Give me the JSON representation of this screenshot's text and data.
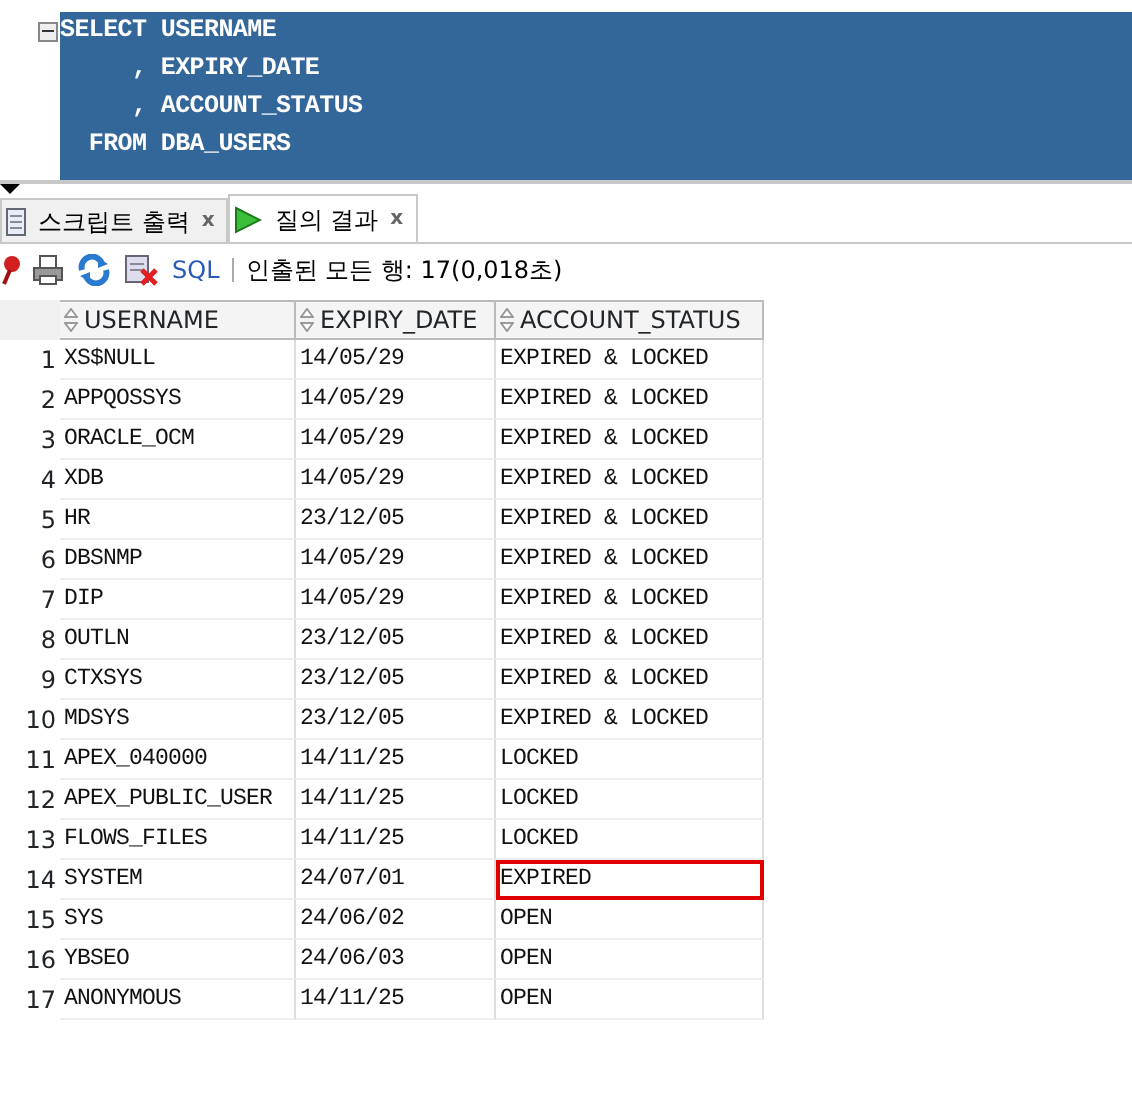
{
  "editor": {
    "lines": [
      {
        "text": "SELECT USERNAME",
        "foldable": true
      },
      {
        "text": "     , EXPIRY_DATE",
        "foldable": false
      },
      {
        "text": "     , ACCOUNT_STATUS",
        "foldable": false
      },
      {
        "text": "  FROM DBA_USERS",
        "foldable": false
      }
    ]
  },
  "tabs": [
    {
      "label": "스크립트 출력",
      "selected": false,
      "close": "x"
    },
    {
      "label": "질의 결과",
      "selected": true,
      "close": "x"
    }
  ],
  "toolbar": {
    "sql": "SQL",
    "status": "인출된 모든 행: 17(0,018초)"
  },
  "table": {
    "columns": [
      "USERNAME",
      "EXPIRY_DATE",
      "ACCOUNT_STATUS"
    ],
    "rows": [
      {
        "num": "1",
        "cells": [
          "XS$NULL",
          "14/05/29",
          "EXPIRED & LOCKED"
        ],
        "highlighted": false
      },
      {
        "num": "2",
        "cells": [
          "APPQOSSYS",
          "14/05/29",
          "EXPIRED & LOCKED"
        ],
        "highlighted": false
      },
      {
        "num": "3",
        "cells": [
          "ORACLE_OCM",
          "14/05/29",
          "EXPIRED & LOCKED"
        ],
        "highlighted": false
      },
      {
        "num": "4",
        "cells": [
          "XDB",
          "14/05/29",
          "EXPIRED & LOCKED"
        ],
        "highlighted": false
      },
      {
        "num": "5",
        "cells": [
          "HR",
          "23/12/05",
          "EXPIRED & LOCKED"
        ],
        "highlighted": false
      },
      {
        "num": "6",
        "cells": [
          "DBSNMP",
          "14/05/29",
          "EXPIRED & LOCKED"
        ],
        "highlighted": false
      },
      {
        "num": "7",
        "cells": [
          "DIP",
          "14/05/29",
          "EXPIRED & LOCKED"
        ],
        "highlighted": false
      },
      {
        "num": "8",
        "cells": [
          "OUTLN",
          "23/12/05",
          "EXPIRED & LOCKED"
        ],
        "highlighted": false
      },
      {
        "num": "9",
        "cells": [
          "CTXSYS",
          "23/12/05",
          "EXPIRED & LOCKED"
        ],
        "highlighted": false
      },
      {
        "num": "10",
        "cells": [
          "MDSYS",
          "23/12/05",
          "EXPIRED & LOCKED"
        ],
        "highlighted": false
      },
      {
        "num": "11",
        "cells": [
          "APEX_040000",
          "14/11/25",
          "LOCKED"
        ],
        "highlighted": false
      },
      {
        "num": "12",
        "cells": [
          "APEX_PUBLIC_USER",
          "14/11/25",
          "LOCKED"
        ],
        "highlighted": false
      },
      {
        "num": "13",
        "cells": [
          "FLOWS_FILES",
          "14/11/25",
          "LOCKED"
        ],
        "highlighted": false
      },
      {
        "num": "14",
        "cells": [
          "SYSTEM",
          "24/07/01",
          "EXPIRED"
        ],
        "highlighted": true
      },
      {
        "num": "15",
        "cells": [
          "SYS",
          "24/06/02",
          "OPEN"
        ],
        "highlighted": false
      },
      {
        "num": "16",
        "cells": [
          "YBSEO",
          "24/06/03",
          "OPEN"
        ],
        "highlighted": false
      },
      {
        "num": "17",
        "cells": [
          "ANONYMOUS",
          "14/11/25",
          "OPEN"
        ],
        "highlighted": false
      }
    ]
  }
}
